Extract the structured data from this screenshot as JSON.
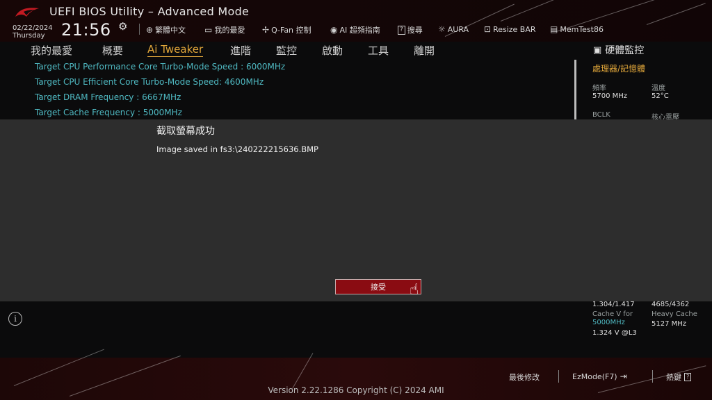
{
  "header": {
    "title": "UEFI BIOS Utility – Advanced Mode",
    "date": "02/22/2024",
    "weekday": "Thursday",
    "time": "21:56"
  },
  "toolbar": [
    {
      "icon": "globe-icon",
      "glyph": "🌐",
      "label": "繁體中文"
    },
    {
      "icon": "favorites-icon",
      "glyph": "▭",
      "label": "我的最愛"
    },
    {
      "icon": "fan-icon",
      "glyph": "✢",
      "label": "Q-Fan 控制"
    },
    {
      "icon": "ai-icon",
      "glyph": "◉",
      "label": "AI 超頻指南"
    },
    {
      "icon": "search-icon",
      "glyph": "?",
      "label": "搜尋"
    },
    {
      "icon": "aura-icon",
      "glyph": "☼",
      "label": "AURA"
    },
    {
      "icon": "resize-bar-icon",
      "glyph": "⊡",
      "label": "Resize BAR"
    },
    {
      "icon": "memtest-icon",
      "glyph": "▤",
      "label": "MemTest86"
    }
  ],
  "nav": [
    {
      "label": "我的最愛"
    },
    {
      "label": "概要"
    },
    {
      "label": "Ai Tweaker"
    },
    {
      "label": "進階"
    },
    {
      "label": "監控"
    },
    {
      "label": "啟動"
    },
    {
      "label": "工具"
    },
    {
      "label": "離開"
    }
  ],
  "nav_active": "Ai Tweaker",
  "rows": [
    "Target CPU Performance Core Turbo-Mode Speed : 6000MHz",
    "Target CPU Efficient Core Turbo-Mode Speed: 4600MHz",
    "Target DRAM Frequency : 6667MHz",
    "Target Cache Frequency : 5000MHz"
  ],
  "hw": {
    "title": "硬體監控",
    "subtitle": "處理器/記憶體",
    "freq_label": "頻率",
    "freq_value": "5700 MHz",
    "temp_label": "溫度",
    "temp_value": "52°C",
    "bclk_label": "BCLK",
    "core_v_label": "核心電壓",
    "ratio_a": "1.304/1.417",
    "ratio_b": "4685/4362",
    "cache_v_label": "Cache V for",
    "cache_v_freq": "5000MHz",
    "heavy_cache_label": "Heavy Cache",
    "heavy_cache_value": "5127 MHz",
    "volt_l3": "1.324 V @L3"
  },
  "dialog": {
    "title": "截取螢幕成功",
    "message": "Image saved in fs3:\\240222215636.BMP",
    "accept_label": "接受"
  },
  "footer": {
    "last_modified": "最後修改",
    "ezmode": "EzMode(F7)",
    "hotkeys": "熱鍵",
    "hotkeys_key": "?",
    "version": "Version 2.22.1286 Copyright (C) 2024 AMI"
  },
  "colors": {
    "accent": "#e0a63a",
    "cyan": "#4fb9c2",
    "button_red": "#8a0c12"
  }
}
